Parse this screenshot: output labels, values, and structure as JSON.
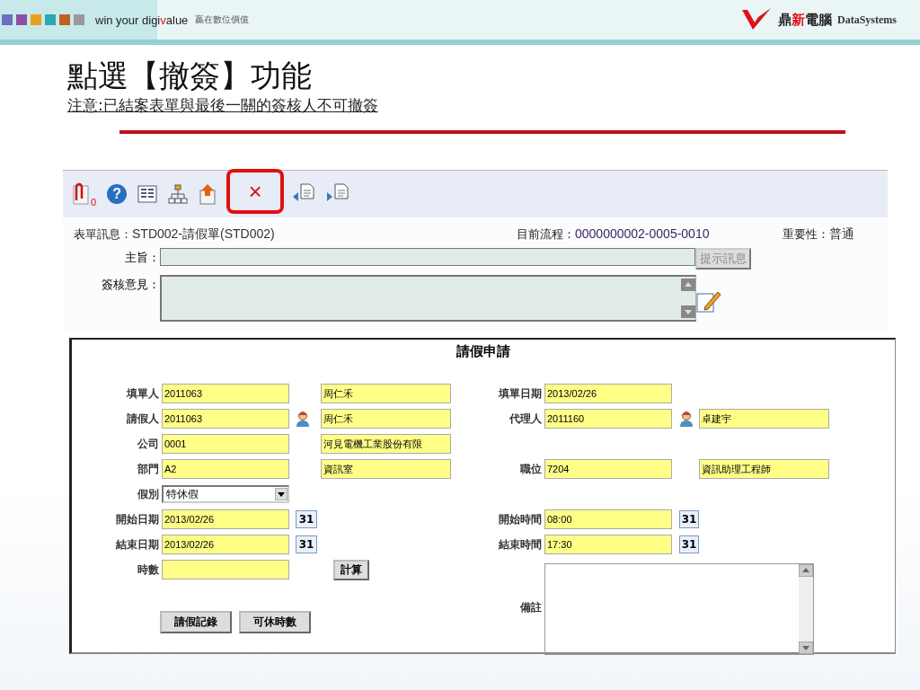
{
  "header": {
    "tagline": {
      "before": "win your digi",
      "accent": "v",
      "after": "alue"
    },
    "slogan": "贏在數位價值",
    "brand": {
      "before": "鼎",
      "accent": "新",
      "after": "電腦"
    },
    "brand_en": "DataSystems"
  },
  "slide": {
    "title": "點選【撤簽】功能",
    "note": "注意:已結案表單與最後一關的簽核人不可撤簽"
  },
  "toolbar": [
    {
      "kind": "attachment",
      "count": "0",
      "highlighted": false
    },
    {
      "kind": "help",
      "glyph": "?",
      "highlighted": false
    },
    {
      "kind": "form",
      "highlighted": false
    },
    {
      "kind": "flow",
      "highlighted": false
    },
    {
      "kind": "upload",
      "highlighted": false
    },
    {
      "kind": "delete",
      "glyph": "×",
      "highlighted": true
    },
    {
      "kind": "prev",
      "highlighted": false
    },
    {
      "kind": "next",
      "highlighted": false
    }
  ],
  "info": [
    {
      "label": "表單訊息：",
      "value": "STD002-請假單(STD002)"
    },
    {
      "label": "目前流程：",
      "value": "0000000002-0005-0010"
    },
    {
      "label": "重要性：",
      "value": "普通"
    }
  ],
  "subject": {
    "label": "主旨：",
    "button": "提示訊息"
  },
  "comment": {
    "label": "簽核意見："
  },
  "form": {
    "title": "請假申請",
    "rows": [
      {
        "left": {
          "kind": "text",
          "label": "填單人",
          "value": "2011063",
          "name": "周仁禾"
        },
        "right": {
          "kind": "text",
          "label": "填單日期",
          "value": "2013/02/26"
        }
      },
      {
        "left": {
          "kind": "text",
          "label": "請假人",
          "value": "2011063",
          "picker": true,
          "name": "周仁禾"
        },
        "right": {
          "kind": "text",
          "label": "代理人",
          "value": "2011160",
          "picker": true,
          "name": "卓建宇"
        }
      },
      {
        "left": {
          "kind": "text",
          "label": "公司",
          "value": "0001",
          "name": "河見電機工業股份有限"
        }
      },
      {
        "left": {
          "kind": "text",
          "label": "部門",
          "value": "A2",
          "name": "資訊室"
        },
        "right": {
          "kind": "text",
          "label": "職位",
          "value": "7204",
          "name": "資訊助理工程師"
        }
      },
      {
        "left": {
          "kind": "select",
          "label": "假別",
          "value": "特休假"
        }
      },
      {
        "left": {
          "kind": "date",
          "label": "開始日期",
          "value": "2013/02/26",
          "calendar": "31"
        },
        "right": {
          "kind": "date",
          "label": "開始時間",
          "value": "08:00",
          "calendar": "31"
        }
      },
      {
        "left": {
          "kind": "date",
          "label": "結束日期",
          "value": "2013/02/26",
          "calendar": "31"
        },
        "right": {
          "kind": "date",
          "label": "結束時間",
          "value": "17:30",
          "calendar": "31"
        }
      },
      {
        "left": {
          "kind": "text",
          "label": "時數",
          "button": "計算"
        }
      }
    ],
    "remark": {
      "label": "備註"
    },
    "buttons": [
      "請假記錄",
      "可休時數"
    ]
  }
}
